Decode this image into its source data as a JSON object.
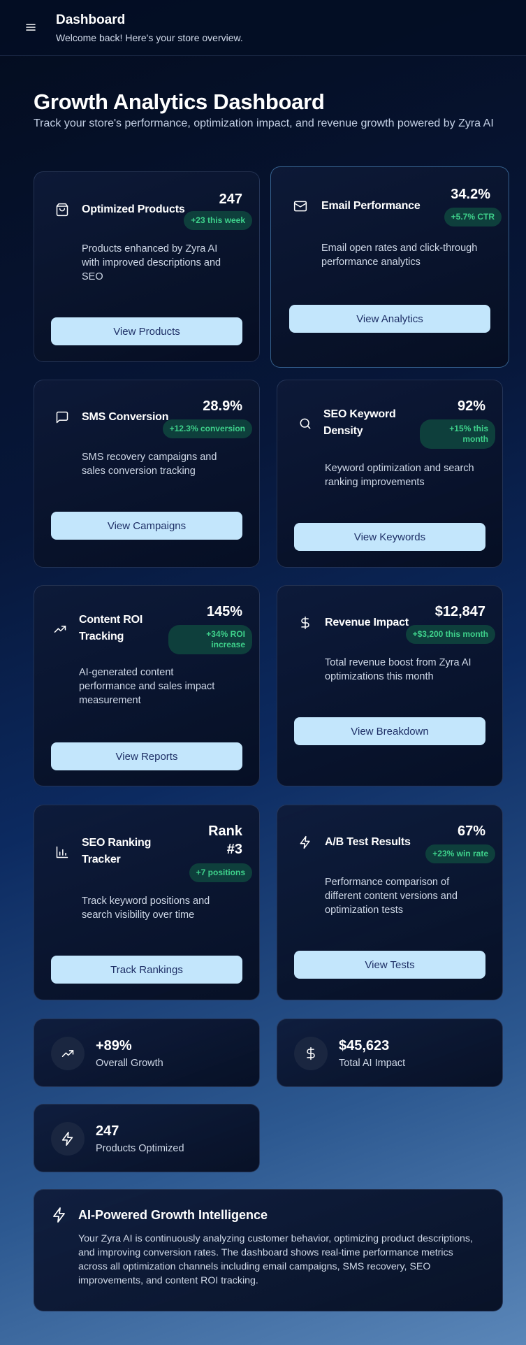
{
  "header": {
    "title": "Dashboard",
    "subtitle": "Welcome back! Here's your store overview."
  },
  "page": {
    "title": "Growth Analytics Dashboard",
    "subtitle": "Track your store's performance, optimization impact, and revenue growth powered by Zyra AI"
  },
  "cards": [
    {
      "icon": "shopping-bag-icon",
      "title": "Optimized Products",
      "value": "247",
      "badge": "+23 this week",
      "description": "Products enhanced by Zyra AI with improved descriptions and SEO",
      "button": "View Products"
    },
    {
      "icon": "mail-icon",
      "title": "Email Performance",
      "value": "34.2%",
      "badge": "+5.7% CTR",
      "description": "Email open rates and click-through performance analytics",
      "button": "View Analytics"
    },
    {
      "icon": "message-icon",
      "title": "SMS Conversion",
      "value": "28.9%",
      "badge": "+12.3% conversion",
      "description": "SMS recovery campaigns and sales conversion tracking",
      "button": "View Campaigns"
    },
    {
      "icon": "search-icon",
      "title": "SEO Keyword Density",
      "value": "92%",
      "badge": "+15% this month",
      "description": "Keyword optimization and search ranking improvements",
      "button": "View Keywords"
    },
    {
      "icon": "trending-up-icon",
      "title": "Content ROI Tracking",
      "value": "145%",
      "badge": "+34% ROI increase",
      "description": "AI-generated content performance and sales impact measurement",
      "button": "View Reports"
    },
    {
      "icon": "dollar-icon",
      "title": "Revenue Impact",
      "value": "$12,847",
      "badge": "+$3,200 this month",
      "description": "Total revenue boost from Zyra AI optimizations this month",
      "button": "View Breakdown"
    },
    {
      "icon": "bar-chart-icon",
      "title": "SEO Ranking Tracker",
      "value": "Rank #3",
      "badge": "+7 positions",
      "description": "Track keyword positions and search visibility over time",
      "button": "Track Rankings"
    },
    {
      "icon": "zap-icon",
      "title": "A/B Test Results",
      "value": "67%",
      "badge": "+23% win rate",
      "description": "Performance comparison of different content versions and optimization tests",
      "button": "View Tests"
    }
  ],
  "stats": [
    {
      "icon": "trending-up-icon",
      "value": "+89%",
      "label": "Overall Growth"
    },
    {
      "icon": "dollar-icon",
      "value": "$45,623",
      "label": "Total AI Impact"
    },
    {
      "icon": "zap-icon",
      "value": "247",
      "label": "Products Optimized"
    }
  ],
  "ai_panel": {
    "icon": "zap-icon",
    "title": "AI-Powered Growth Intelligence",
    "text": "Your Zyra AI is continuously analyzing customer behavior, optimizing product descriptions, and improving conversion rates. The dashboard shows real-time performance metrics across all optimization channels including email campaigns, SMS recovery, SEO improvements, and content ROI tracking."
  },
  "colors": {
    "accent_button": "#c3e6fc",
    "button_text": "#1e2f66",
    "badge_bg": "#0e3f3c",
    "badge_text": "#3ed18b"
  }
}
